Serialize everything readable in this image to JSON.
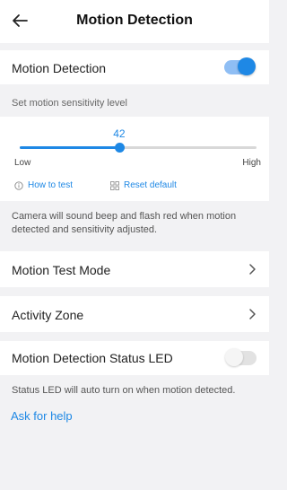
{
  "header": {
    "title": "Motion Detection",
    "back_icon": "back-arrow-icon"
  },
  "motion_detection": {
    "label": "Motion Detection",
    "enabled": true
  },
  "sensitivity": {
    "hint": "Set motion sensitivity level",
    "value": "42",
    "min_label": "Low",
    "max_label": "High",
    "level": 42,
    "max": 100,
    "how_to_test": "How to test",
    "reset_default": "Reset default"
  },
  "sensitivity_note": "Camera will sound beep and flash red when motion detected and sensitivity adjusted.",
  "motion_test_mode": {
    "label": "Motion Test Mode"
  },
  "activity_zone": {
    "label": "Activity Zone"
  },
  "status_led": {
    "label": "Motion Detection Status LED",
    "enabled": false,
    "note": "Status LED will auto turn on when motion detected."
  },
  "help": {
    "label": "Ask for help"
  },
  "colors": {
    "accent": "#1e88e5",
    "background": "#f2f2f4"
  }
}
